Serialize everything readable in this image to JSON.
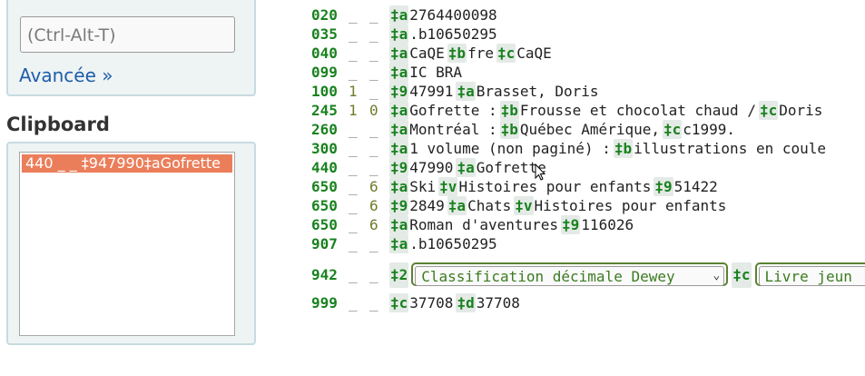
{
  "sidebar": {
    "search_placeholder": "(Ctrl-Alt-T)",
    "advanced_label": "Avancée »",
    "clipboard_title": "Clipboard",
    "clipboard_items": [
      "440 _ _ ‡947990‡aGofrette"
    ]
  },
  "record": {
    "fields": [
      {
        "tag": "020",
        "ind1": "_",
        "ind2": "_",
        "subfields": [
          {
            "code": "‡a",
            "value": "2764400098"
          }
        ]
      },
      {
        "tag": "035",
        "ind1": "_",
        "ind2": "_",
        "subfields": [
          {
            "code": "‡a",
            "value": ".b10650295"
          }
        ]
      },
      {
        "tag": "040",
        "ind1": "_",
        "ind2": "_",
        "subfields": [
          {
            "code": "‡a",
            "value": "CaQE"
          },
          {
            "code": "‡b",
            "value": "fre"
          },
          {
            "code": "‡c",
            "value": "CaQE"
          }
        ]
      },
      {
        "tag": "099",
        "ind1": "_",
        "ind2": "_",
        "subfields": [
          {
            "code": "‡a",
            "value": "IC BRA"
          }
        ]
      },
      {
        "tag": "100",
        "ind1": "1",
        "ind2": "_",
        "subfields": [
          {
            "code": "‡9",
            "value": "47991"
          },
          {
            "code": "‡a",
            "value": "Brasset, Doris"
          }
        ]
      },
      {
        "tag": "245",
        "ind1": "1",
        "ind2": "0",
        "subfields": [
          {
            "code": "‡a",
            "value": "Gofrette :"
          },
          {
            "code": "‡b",
            "value": "Frousse et chocolat chaud /"
          },
          {
            "code": "‡c",
            "value": "Doris"
          }
        ]
      },
      {
        "tag": "260",
        "ind1": "_",
        "ind2": "_",
        "subfields": [
          {
            "code": "‡a",
            "value": "Montréal :"
          },
          {
            "code": "‡b",
            "value": "Québec Amérique,"
          },
          {
            "code": "‡c",
            "value": "c1999."
          }
        ]
      },
      {
        "tag": "300",
        "ind1": "_",
        "ind2": "_",
        "subfields": [
          {
            "code": "‡a",
            "value": "1 volume (non paginé) :"
          },
          {
            "code": "‡b",
            "value": "illustrations en coule"
          }
        ]
      },
      {
        "tag": "440",
        "ind1": "_",
        "ind2": "_",
        "subfields": [
          {
            "code": "‡9",
            "value": "47990"
          },
          {
            "code": "‡a",
            "value": "Gofrette"
          }
        ]
      },
      {
        "tag": "650",
        "ind1": "_",
        "ind2": "6",
        "subfields": [
          {
            "code": "‡a",
            "value": "Ski"
          },
          {
            "code": "‡v",
            "value": "Histoires pour enfants"
          },
          {
            "code": "‡9",
            "value": "51422"
          }
        ]
      },
      {
        "tag": "650",
        "ind1": "_",
        "ind2": "6",
        "subfields": [
          {
            "code": "‡9",
            "value": "2849"
          },
          {
            "code": "‡a",
            "value": "Chats"
          },
          {
            "code": "‡v",
            "value": "Histoires pour enfants"
          }
        ]
      },
      {
        "tag": "650",
        "ind1": "_",
        "ind2": "6",
        "subfields": [
          {
            "code": "‡a",
            "value": "Roman d'aventures"
          },
          {
            "code": "‡9",
            "value": "116026"
          }
        ]
      },
      {
        "tag": "907",
        "ind1": "_",
        "ind2": "_",
        "subfields": [
          {
            "code": "‡a",
            "value": ".b10650295"
          }
        ]
      }
    ],
    "field_942": {
      "tag": "942",
      "ind1": "_",
      "ind2": "_",
      "code1": "‡2",
      "select1_value": "Classification décimale Dewey",
      "code2": "‡c",
      "select2_value": "Livre jeun"
    },
    "field_999": {
      "tag": "999",
      "ind1": "_",
      "ind2": "_",
      "subfields": [
        {
          "code": "‡c",
          "value": "37708"
        },
        {
          "code": "‡d",
          "value": "37708"
        }
      ]
    }
  }
}
